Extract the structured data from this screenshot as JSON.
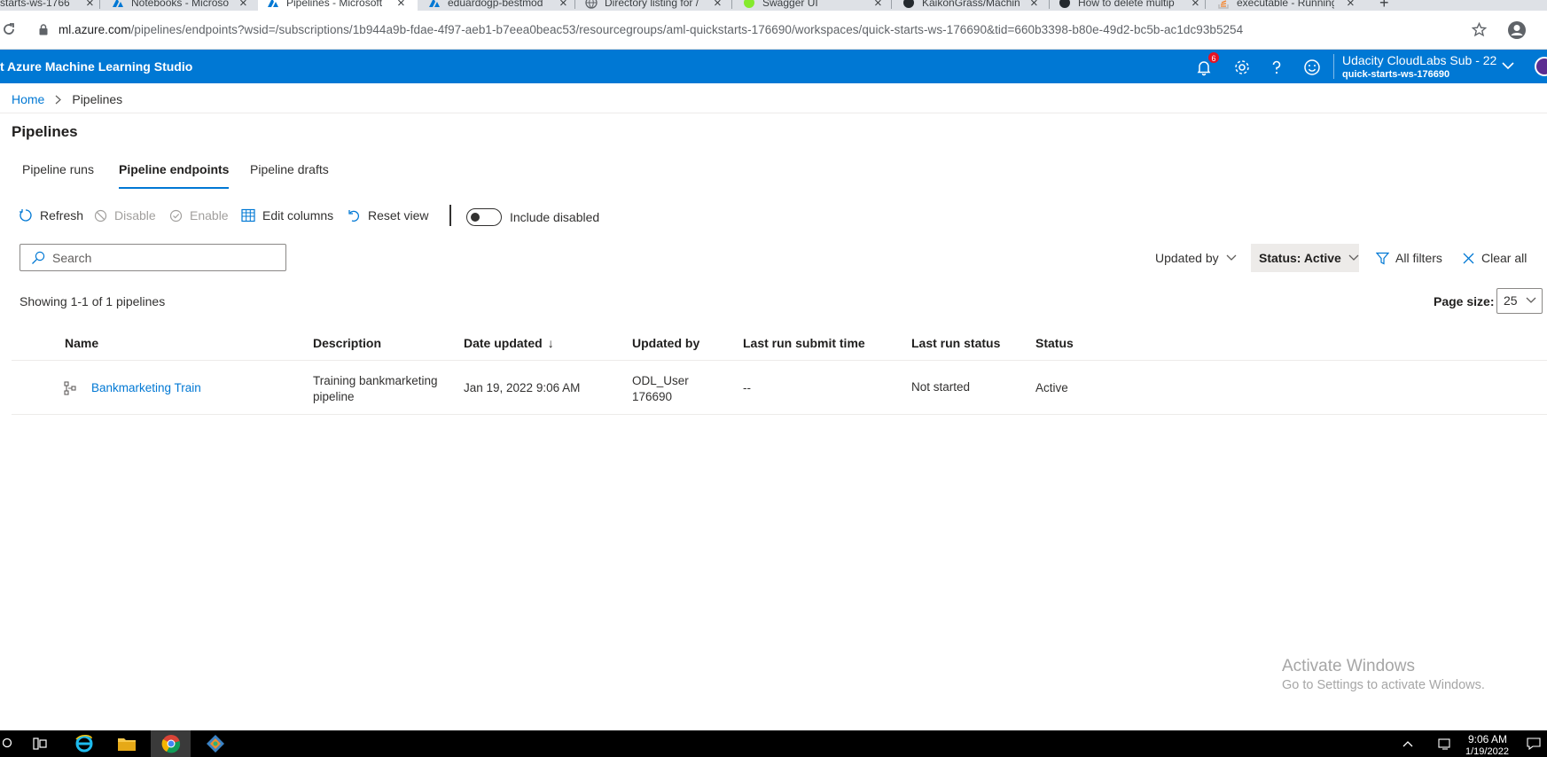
{
  "browser": {
    "tabs": [
      {
        "title": "starts-ws-1766",
        "icon": "azure-icon"
      },
      {
        "title": "Notebooks - Microso",
        "icon": "azure-icon"
      },
      {
        "title": "Pipelines - Microsoft",
        "icon": "azure-icon",
        "active": true
      },
      {
        "title": "eduardogp-bestmod",
        "icon": "azure-icon"
      },
      {
        "title": "Directory listing for /",
        "icon": "globe-icon"
      },
      {
        "title": "Swagger UI",
        "icon": "swagger-icon"
      },
      {
        "title": "KaikonGrass/Machine",
        "icon": "github-icon"
      },
      {
        "title": "How to delete multip",
        "icon": "github-icon"
      },
      {
        "title": "executable - Running",
        "icon": "stackoverflow-icon"
      }
    ],
    "url_host": "ml.azure.com",
    "url_path": "/pipelines/endpoints?wsid=/subscriptions/1b944a9b-fdae-4f97-aeb1-b7eea0beac53/resourcegroups/aml-quickstarts-176690/workspaces/quick-starts-ws-176690&tid=660b3398-b80e-49d2-bc5b-ac1dc93b5254"
  },
  "header": {
    "app_title": "t Azure Machine Learning Studio",
    "notification_count": "6",
    "account_name": "Udacity CloudLabs Sub - 22",
    "workspace": "quick-starts-ws-176690",
    "accent": "#0078d4"
  },
  "breadcrumb": {
    "home": "Home",
    "current": "Pipelines"
  },
  "page_title": "Pipelines",
  "tabs": [
    {
      "label": "Pipeline runs"
    },
    {
      "label": "Pipeline endpoints",
      "selected": true
    },
    {
      "label": "Pipeline drafts"
    }
  ],
  "toolbar": {
    "refresh": "Refresh",
    "disable": "Disable",
    "enable": "Enable",
    "edit_columns": "Edit columns",
    "reset_view": "Reset view",
    "include_disabled": "Include disabled",
    "include_disabled_on": false
  },
  "search": {
    "placeholder": "Search",
    "value": ""
  },
  "filters": {
    "updated_by": "Updated by",
    "status": "Status: Active",
    "all_filters": "All filters",
    "clear_all": "Clear all"
  },
  "summary": "Showing 1-1 of 1 pipelines",
  "page_size": {
    "label": "Page size:",
    "value": "25"
  },
  "table": {
    "columns": [
      "Name",
      "Description",
      "Date updated",
      "Updated by",
      "Last run submit time",
      "Last run status",
      "Status"
    ],
    "sort_indicator": "↓",
    "rows": [
      {
        "name": "Bankmarketing Train",
        "description_line1": "Training bankmarketing",
        "description_line2": "pipeline",
        "date_updated": "Jan 19, 2022 9:06 AM",
        "updated_by_line1": "ODL_User",
        "updated_by_line2": "176690",
        "last_run_submit_time": "--",
        "last_run_status": "Not started",
        "status": "Active"
      }
    ]
  },
  "watermark": {
    "line1": "Activate Windows",
    "line2": "Go to Settings to activate Windows."
  },
  "taskbar": {
    "time": "9:06 AM",
    "date": "1/19/2022"
  }
}
